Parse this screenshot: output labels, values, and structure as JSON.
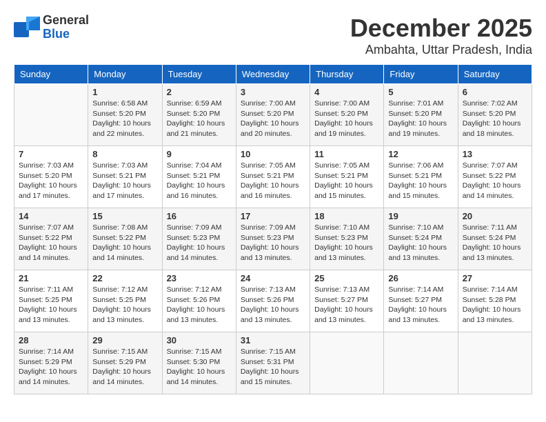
{
  "logo": {
    "line1": "General",
    "line2": "Blue"
  },
  "title": {
    "month": "December 2025",
    "location": "Ambahta, Uttar Pradesh, India"
  },
  "weekdays": [
    "Sunday",
    "Monday",
    "Tuesday",
    "Wednesday",
    "Thursday",
    "Friday",
    "Saturday"
  ],
  "weeks": [
    [
      {
        "day": "",
        "info": ""
      },
      {
        "day": "1",
        "info": "Sunrise: 6:58 AM\nSunset: 5:20 PM\nDaylight: 10 hours\nand 22 minutes."
      },
      {
        "day": "2",
        "info": "Sunrise: 6:59 AM\nSunset: 5:20 PM\nDaylight: 10 hours\nand 21 minutes."
      },
      {
        "day": "3",
        "info": "Sunrise: 7:00 AM\nSunset: 5:20 PM\nDaylight: 10 hours\nand 20 minutes."
      },
      {
        "day": "4",
        "info": "Sunrise: 7:00 AM\nSunset: 5:20 PM\nDaylight: 10 hours\nand 19 minutes."
      },
      {
        "day": "5",
        "info": "Sunrise: 7:01 AM\nSunset: 5:20 PM\nDaylight: 10 hours\nand 19 minutes."
      },
      {
        "day": "6",
        "info": "Sunrise: 7:02 AM\nSunset: 5:20 PM\nDaylight: 10 hours\nand 18 minutes."
      }
    ],
    [
      {
        "day": "7",
        "info": "Sunrise: 7:03 AM\nSunset: 5:20 PM\nDaylight: 10 hours\nand 17 minutes."
      },
      {
        "day": "8",
        "info": "Sunrise: 7:03 AM\nSunset: 5:21 PM\nDaylight: 10 hours\nand 17 minutes."
      },
      {
        "day": "9",
        "info": "Sunrise: 7:04 AM\nSunset: 5:21 PM\nDaylight: 10 hours\nand 16 minutes."
      },
      {
        "day": "10",
        "info": "Sunrise: 7:05 AM\nSunset: 5:21 PM\nDaylight: 10 hours\nand 16 minutes."
      },
      {
        "day": "11",
        "info": "Sunrise: 7:05 AM\nSunset: 5:21 PM\nDaylight: 10 hours\nand 15 minutes."
      },
      {
        "day": "12",
        "info": "Sunrise: 7:06 AM\nSunset: 5:21 PM\nDaylight: 10 hours\nand 15 minutes."
      },
      {
        "day": "13",
        "info": "Sunrise: 7:07 AM\nSunset: 5:22 PM\nDaylight: 10 hours\nand 14 minutes."
      }
    ],
    [
      {
        "day": "14",
        "info": "Sunrise: 7:07 AM\nSunset: 5:22 PM\nDaylight: 10 hours\nand 14 minutes."
      },
      {
        "day": "15",
        "info": "Sunrise: 7:08 AM\nSunset: 5:22 PM\nDaylight: 10 hours\nand 14 minutes."
      },
      {
        "day": "16",
        "info": "Sunrise: 7:09 AM\nSunset: 5:23 PM\nDaylight: 10 hours\nand 14 minutes."
      },
      {
        "day": "17",
        "info": "Sunrise: 7:09 AM\nSunset: 5:23 PM\nDaylight: 10 hours\nand 13 minutes."
      },
      {
        "day": "18",
        "info": "Sunrise: 7:10 AM\nSunset: 5:23 PM\nDaylight: 10 hours\nand 13 minutes."
      },
      {
        "day": "19",
        "info": "Sunrise: 7:10 AM\nSunset: 5:24 PM\nDaylight: 10 hours\nand 13 minutes."
      },
      {
        "day": "20",
        "info": "Sunrise: 7:11 AM\nSunset: 5:24 PM\nDaylight: 10 hours\nand 13 minutes."
      }
    ],
    [
      {
        "day": "21",
        "info": "Sunrise: 7:11 AM\nSunset: 5:25 PM\nDaylight: 10 hours\nand 13 minutes."
      },
      {
        "day": "22",
        "info": "Sunrise: 7:12 AM\nSunset: 5:25 PM\nDaylight: 10 hours\nand 13 minutes."
      },
      {
        "day": "23",
        "info": "Sunrise: 7:12 AM\nSunset: 5:26 PM\nDaylight: 10 hours\nand 13 minutes."
      },
      {
        "day": "24",
        "info": "Sunrise: 7:13 AM\nSunset: 5:26 PM\nDaylight: 10 hours\nand 13 minutes."
      },
      {
        "day": "25",
        "info": "Sunrise: 7:13 AM\nSunset: 5:27 PM\nDaylight: 10 hours\nand 13 minutes."
      },
      {
        "day": "26",
        "info": "Sunrise: 7:14 AM\nSunset: 5:27 PM\nDaylight: 10 hours\nand 13 minutes."
      },
      {
        "day": "27",
        "info": "Sunrise: 7:14 AM\nSunset: 5:28 PM\nDaylight: 10 hours\nand 13 minutes."
      }
    ],
    [
      {
        "day": "28",
        "info": "Sunrise: 7:14 AM\nSunset: 5:29 PM\nDaylight: 10 hours\nand 14 minutes."
      },
      {
        "day": "29",
        "info": "Sunrise: 7:15 AM\nSunset: 5:29 PM\nDaylight: 10 hours\nand 14 minutes."
      },
      {
        "day": "30",
        "info": "Sunrise: 7:15 AM\nSunset: 5:30 PM\nDaylight: 10 hours\nand 14 minutes."
      },
      {
        "day": "31",
        "info": "Sunrise: 7:15 AM\nSunset: 5:31 PM\nDaylight: 10 hours\nand 15 minutes."
      },
      {
        "day": "",
        "info": ""
      },
      {
        "day": "",
        "info": ""
      },
      {
        "day": "",
        "info": ""
      }
    ]
  ]
}
